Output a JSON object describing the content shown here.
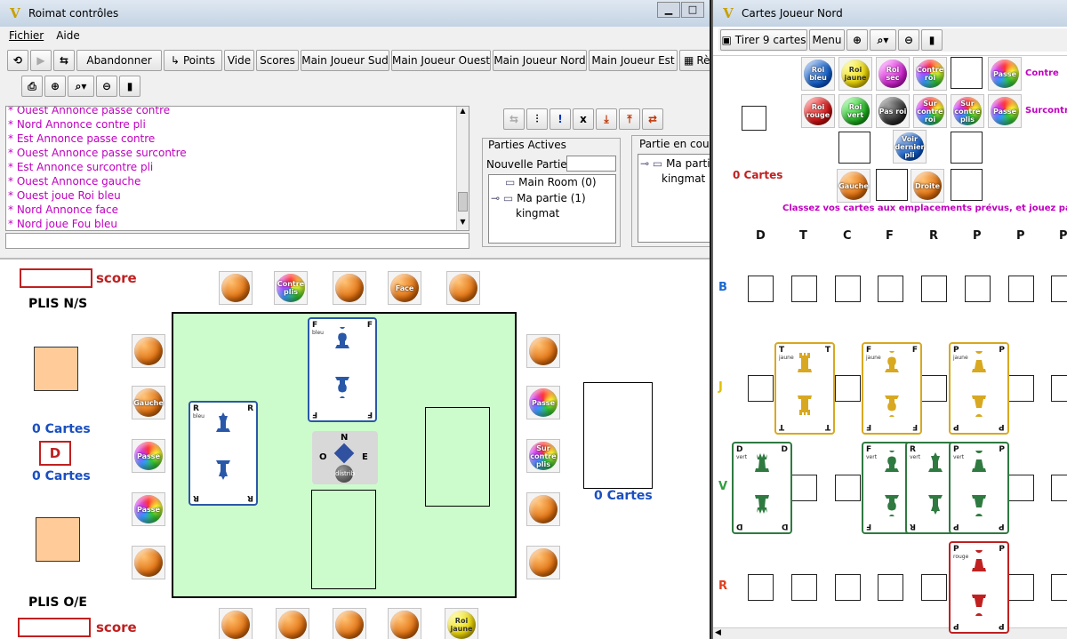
{
  "main_window": {
    "title": "Roimat contrôles",
    "menu": [
      "Fichier",
      "Aide"
    ],
    "toolbar": [
      "Abandonner",
      "Points",
      "Vide",
      "Scores",
      "Main Joueur Sud",
      "Main Joueur Ouest",
      "Main Joueur Nord",
      "Main Joueur Est",
      "Rè"
    ],
    "log": [
      "* Ouest Annonce passe contre",
      "* Nord Annonce contre pli",
      "* Est Annonce passe contre",
      "* Ouest Annonce passe surcontre",
      "* Est Annonce surcontre pli",
      "* Ouest Annonce gauche",
      "* Ouest joue Roi bleu",
      "* Nord Annonce face",
      "* Nord joue Fou bleu"
    ],
    "parties_actives": {
      "title": "Parties Actives",
      "nouvelle_label": "Nouvelle Partie:",
      "tree": [
        "Main Room (0)",
        "Ma partie (1)",
        "kingmat"
      ]
    },
    "partie_en_cours": {
      "title": "Partie en cours",
      "tree": [
        "Ma partie",
        "kingmat"
      ]
    },
    "board": {
      "score_label": "score",
      "plis_ns": "PLIS N/S",
      "plis_oe": "PLIS O/E",
      "cards_label": "0 Cartes",
      "dealer": "D",
      "compass": [
        "N",
        "O",
        "E",
        "distrib"
      ],
      "top_balls": [
        "",
        "Contre plis",
        "",
        "Face",
        ""
      ],
      "left_balls": [
        "",
        "Gauche",
        "Passe",
        "Passe",
        ""
      ],
      "right_balls": [
        "",
        "Passe",
        "Sur contre plis",
        "",
        ""
      ],
      "bottom_balls": [
        "",
        "",
        "",
        "",
        "Roi jaune"
      ],
      "played_cards": [
        {
          "letter": "F",
          "color_name": "bleu"
        },
        {
          "letter": "R",
          "color_name": "bleu"
        }
      ]
    }
  },
  "side_window": {
    "title": "Cartes Joueur Nord",
    "toolbar": [
      "Tirer 9 cartes",
      "Menu"
    ],
    "row1": [
      "Roi bleu",
      "Roi jaune",
      "Roi sec",
      "Contre roi",
      "",
      "Passe"
    ],
    "row2": [
      "Roi rouge",
      "Roi vert",
      "Pas roi",
      "Sur contre roi",
      "Sur contre plis",
      "Passe"
    ],
    "row3_ball": "Voir dernier pli",
    "row4": [
      "Gauche",
      "",
      "Droite",
      ""
    ],
    "contre_label": "Contre",
    "surcontre_label": "Surcontre",
    "cards_label": "0 Cartes",
    "instruction": "Classez vos cartes aux emplacements prévus, et jouez par clic droit",
    "columns": [
      "D",
      "T",
      "C",
      "F",
      "R",
      "P",
      "P",
      "P"
    ],
    "rows": [
      "B",
      "J",
      "V",
      "R"
    ],
    "hand": [
      {
        "letter": "T",
        "color_name": "jaune"
      },
      {
        "letter": "F",
        "color_name": "jaune"
      },
      {
        "letter": "P",
        "color_name": "jaune"
      },
      {
        "letter": "D",
        "color_name": "vert"
      },
      {
        "letter": "F",
        "color_name": "vert"
      },
      {
        "letter": "R",
        "color_name": "vert"
      },
      {
        "letter": "P",
        "color_name": "vert"
      },
      {
        "letter": "P",
        "color_name": "rouge"
      }
    ]
  },
  "colors": {
    "log_text": "#c000c0",
    "score_red": "#c02020",
    "cards_blue": "#1a4fc0",
    "instruction": "#c000c0",
    "bleu": "#2a58a8",
    "jaune": "#d8a820",
    "vert": "#2f7a40",
    "rouge": "#c02020"
  }
}
